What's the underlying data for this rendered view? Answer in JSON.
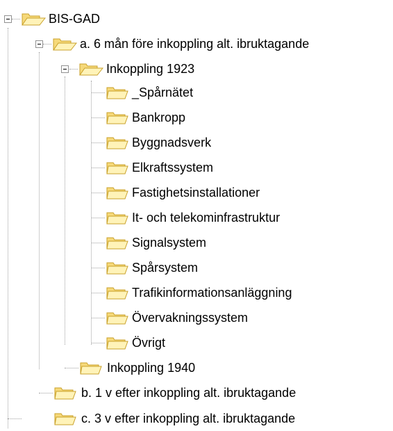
{
  "tree": {
    "root": {
      "label": "BIS-GAD",
      "icon": "folder-open-icon",
      "expanded": true,
      "children": [
        {
          "label": "a. 6 mån före inkoppling alt. ibruktagande",
          "icon": "folder-open-icon",
          "expanded": true,
          "children": [
            {
              "label": "Inkoppling 1923",
              "icon": "folder-open-icon",
              "expanded": true,
              "children": [
                {
                  "label": "_Spårnätet",
                  "icon": "folder-icon"
                },
                {
                  "label": "Bankropp",
                  "icon": "folder-icon"
                },
                {
                  "label": "Byggnadsverk",
                  "icon": "folder-icon"
                },
                {
                  "label": "Elkraftssystem",
                  "icon": "folder-icon"
                },
                {
                  "label": "Fastighetsinstallationer",
                  "icon": "folder-icon"
                },
                {
                  "label": "It- och telekominfrastruktur",
                  "icon": "folder-icon"
                },
                {
                  "label": "Signalsystem",
                  "icon": "folder-icon"
                },
                {
                  "label": "Spårsystem",
                  "icon": "folder-icon"
                },
                {
                  "label": "Trafikinformationsanläggning",
                  "icon": "folder-icon"
                },
                {
                  "label": "Övervakningssystem",
                  "icon": "folder-icon"
                },
                {
                  "label": "Övrigt",
                  "icon": "folder-icon"
                }
              ]
            },
            {
              "label": "Inkoppling 1940",
              "icon": "folder-icon"
            }
          ]
        },
        {
          "label": "b. 1 v efter inkoppling alt. ibruktagande",
          "icon": "folder-icon"
        },
        {
          "label": "c. 3 v efter  inkoppling alt. ibruktagande",
          "icon": "folder-icon"
        }
      ]
    }
  },
  "colors": {
    "folder_fill": "#f6d97a",
    "folder_edge": "#c9a12b",
    "folder_highlight": "#fff3b8",
    "tree_line": "#a0a0a0",
    "expander_border": "#919191"
  }
}
